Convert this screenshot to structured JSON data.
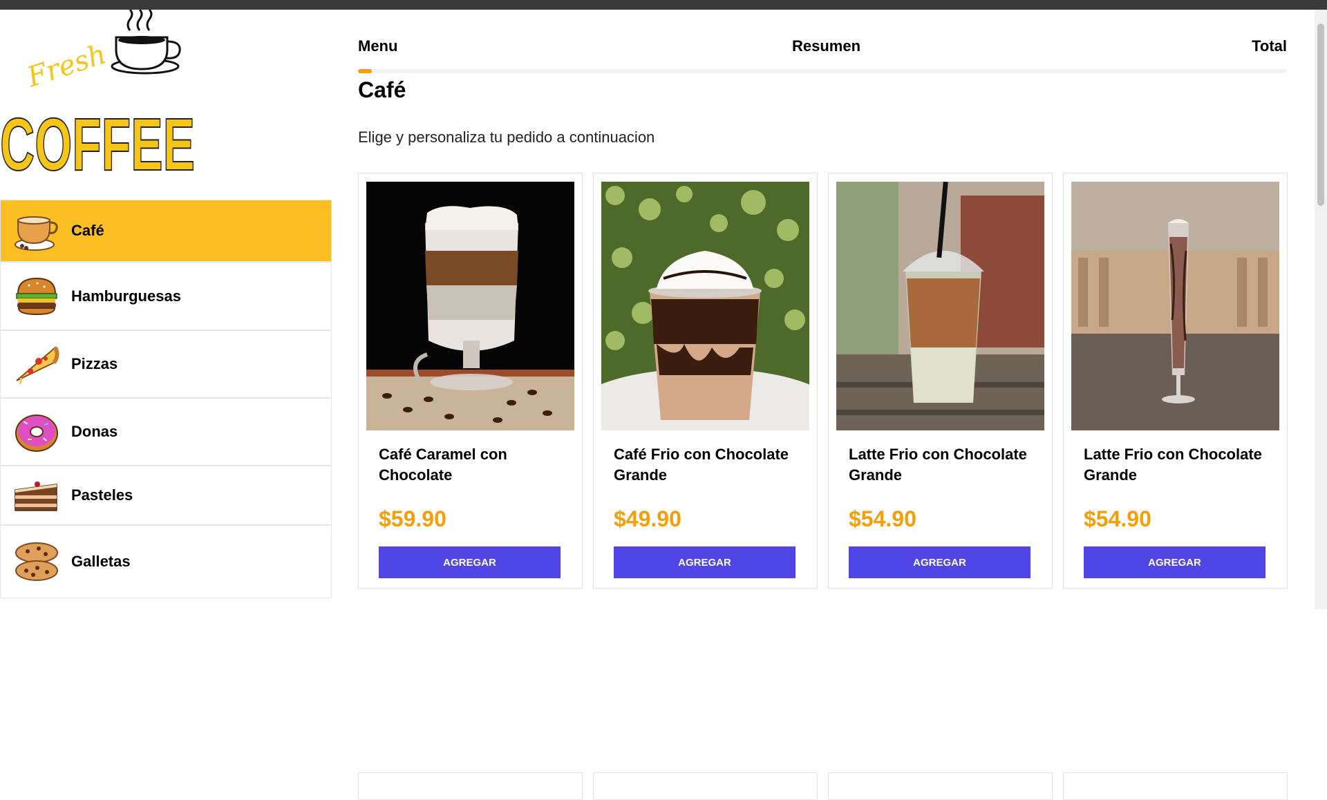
{
  "steps": {
    "menu": "Menu",
    "resumen": "Resumen",
    "total": "Total",
    "progress": 0.015
  },
  "logo": {
    "word_top": "Fresh",
    "word_main": "COFFEE"
  },
  "categories": [
    {
      "label": "Café",
      "icon": "coffee-cup-icon",
      "active": true
    },
    {
      "label": "Hamburguesas",
      "icon": "burger-icon",
      "active": false
    },
    {
      "label": "Pizzas",
      "icon": "pizza-icon",
      "active": false
    },
    {
      "label": "Donas",
      "icon": "donut-icon",
      "active": false
    },
    {
      "label": "Pasteles",
      "icon": "cake-icon",
      "active": false
    },
    {
      "label": "Galletas",
      "icon": "cookies-icon",
      "active": false
    }
  ],
  "section": {
    "title": "Café",
    "subtitle": "Elige y personaliza tu pedido a continuacion"
  },
  "products": [
    {
      "name": "Café Caramel con Chocolate",
      "price": "$59.90",
      "button": "Agregar"
    },
    {
      "name": "Café Frio con Chocolate Grande",
      "price": "$49.90",
      "button": "Agregar"
    },
    {
      "name": "Latte Frio con Chocolate Grande",
      "price": "$54.90",
      "button": "Agregar"
    },
    {
      "name": "Latte Frio con Chocolate Grande",
      "price": "$54.90",
      "button": "Agregar"
    }
  ],
  "colors": {
    "accent": "#fbbf24",
    "price": "#f59e0b",
    "button": "#4f46e5"
  }
}
